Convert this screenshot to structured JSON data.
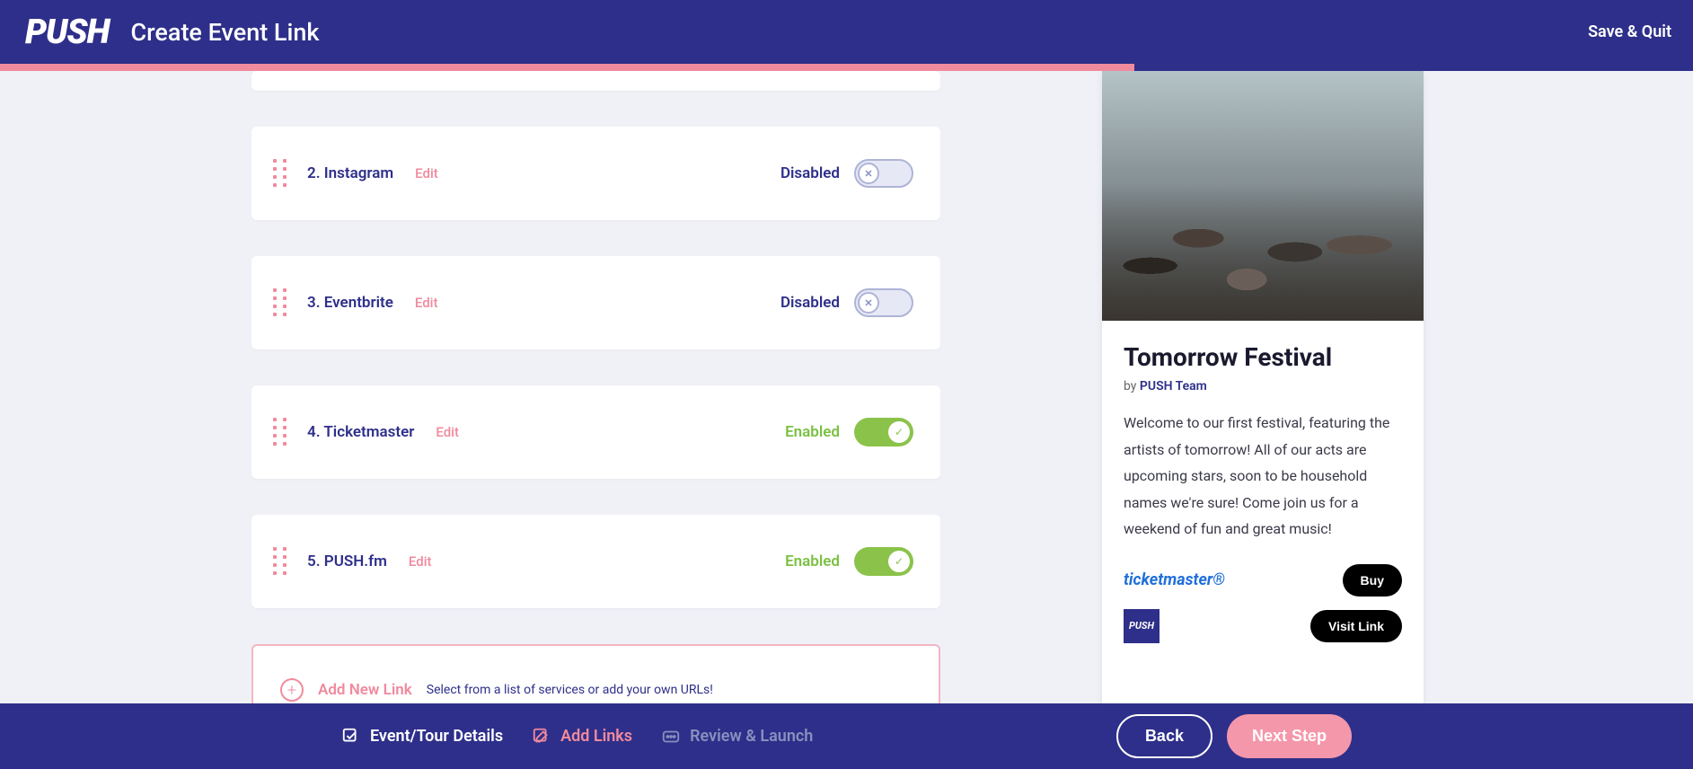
{
  "header": {
    "logo": "PUSH",
    "title": "Create Event Link",
    "save_quit": "Save & Quit"
  },
  "links": [
    {
      "num": "2.",
      "name": "Instagram",
      "edit": "Edit",
      "status": "Disabled",
      "enabled": false
    },
    {
      "num": "3.",
      "name": "Eventbrite",
      "edit": "Edit",
      "status": "Disabled",
      "enabled": false
    },
    {
      "num": "4.",
      "name": "Ticketmaster",
      "edit": "Edit",
      "status": "Enabled",
      "enabled": true
    },
    {
      "num": "5.",
      "name": "PUSH.fm",
      "edit": "Edit",
      "status": "Enabled",
      "enabled": true
    }
  ],
  "add_link": {
    "label": "Add New Link",
    "hint": "Select from a list of services or add your own URLs!"
  },
  "preview": {
    "title": "Tomorrow Festival",
    "by_prefix": "by ",
    "by_name": "PUSH Team",
    "description": "Welcome to our first festival, featuring the artists of tomorrow! All of our acts are upcoming stars, soon to be household names we're sure! Come join us for a weekend of fun and great music!",
    "service_tm": "ticketmaster®",
    "service_push": "PUSH",
    "btn_buy": "Buy",
    "btn_visit": "Visit Link"
  },
  "footer": {
    "step1": "Event/Tour Details",
    "step2": "Add Links",
    "step3": "Review & Launch",
    "back": "Back",
    "next": "Next Step"
  }
}
